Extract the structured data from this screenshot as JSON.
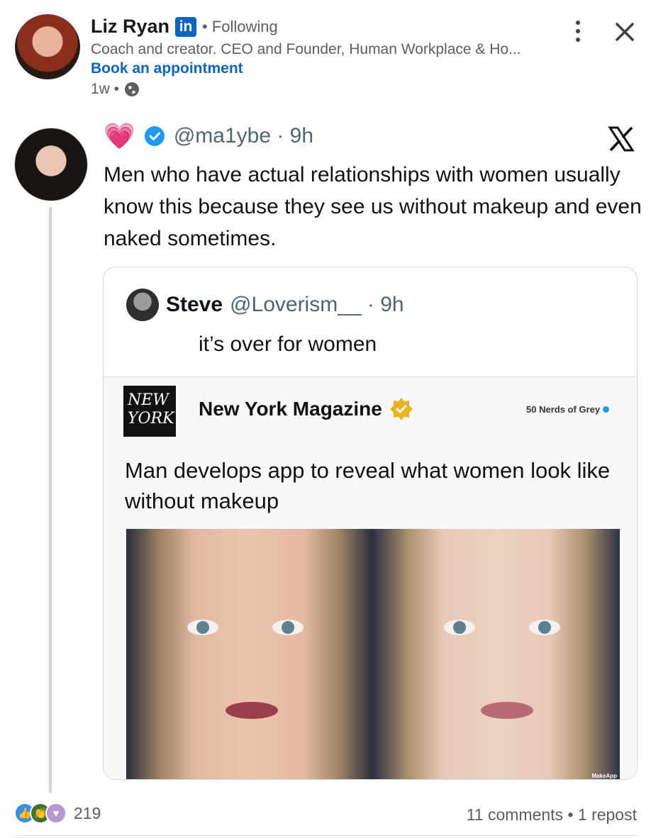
{
  "post": {
    "author_name": "Liz Ryan",
    "platform_badge": "in",
    "following_label": "• Following",
    "headline": "Coach and creator. CEO and Founder, Human Workplace & Ho...",
    "cta": "Book an appointment",
    "age": "1w •"
  },
  "tweet": {
    "emoji": "💗",
    "handle_time": "@ma1ybe · 9h",
    "text": "Men who have actual relationships with women usually know this because they see us without makeup and even naked sometimes."
  },
  "quoted": {
    "name": "Steve",
    "handle_time": "@Loverism__ · 9h",
    "text": "it’s over for women"
  },
  "magazine": {
    "logo_line1": "NEW",
    "logo_line2": "YORK",
    "name": "New York Magazine",
    "source_tag": "50 Nerds of Grey",
    "headline": "Man develops app to reveal what women look like without makeup",
    "watermark": "MakeApp"
  },
  "footer": {
    "reaction_count": "219",
    "social_counts": "11 comments • 1 repost"
  },
  "colors": {
    "linkedin_blue": "#0a66c2",
    "x_verified_blue": "#1d9bf0",
    "heart_pink": "#e64a8f",
    "gold_badge": "#e8b422"
  },
  "icons": [
    "linkedin-badge-icon",
    "globe-icon",
    "more-options-icon",
    "close-icon",
    "verified-icon",
    "x-logo-icon",
    "gold-verified-icon",
    "like-reaction-icon",
    "celebrate-reaction-icon",
    "support-reaction-icon"
  ]
}
